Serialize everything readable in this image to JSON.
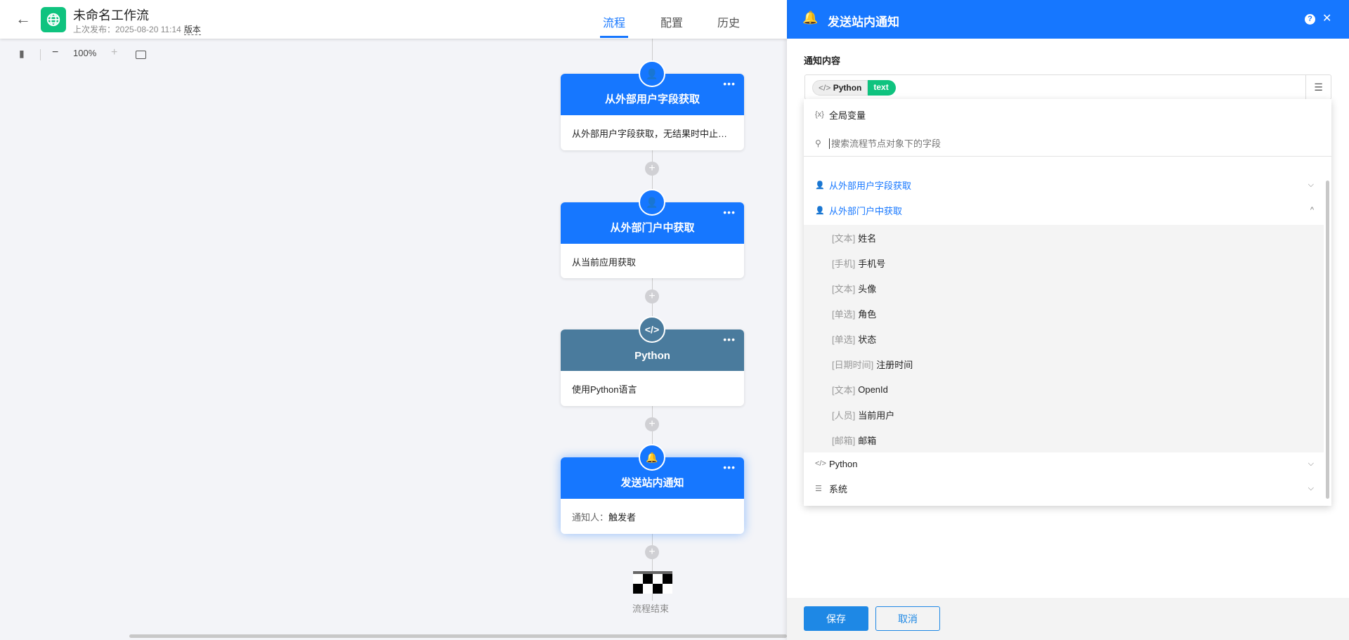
{
  "header": {
    "back_icon": "arrow-left-icon",
    "title": "未命名工作流",
    "published_label": "上次发布：2025-08-20 11:14",
    "version_link": "版本",
    "tabs": [
      {
        "label": "流程",
        "active": true
      },
      {
        "label": "配置"
      },
      {
        "label": "历史"
      }
    ]
  },
  "toolbar": {
    "zoom": "100%",
    "minus": "−",
    "plus": "+"
  },
  "nodes": [
    {
      "title": "从外部用户字段获取",
      "desc": "从外部用户字段获取，无结果时中止…",
      "color": "#1677ff"
    },
    {
      "title": "从外部门户中获取",
      "desc": "从当前应用获取",
      "color": "#1677ff"
    },
    {
      "title": "Python",
      "desc": "使用Python语言",
      "color": "#4a7b9d"
    },
    {
      "title": "发送站内通知",
      "desc_label": "通知人：",
      "desc_value": "触发者",
      "color": "#1677ff"
    }
  ],
  "more": "•••",
  "end_label": "流程结束",
  "panel": {
    "title": "发送站内通知",
    "help": "?",
    "close": "✕",
    "content_label": "通知内容",
    "tag_node": "Python",
    "tag_field": "text",
    "dropdown": {
      "global": "全局变量",
      "global_icon": "{x}",
      "search_placeholder": "搜索流程节点对象下的字段",
      "groups": [
        {
          "label": "从外部用户字段获取",
          "expanded": false
        },
        {
          "label": "从外部门户中获取",
          "expanded": true
        }
      ],
      "items": [
        {
          "type": "[文本]",
          "name": "姓名"
        },
        {
          "type": "[手机]",
          "name": "手机号"
        },
        {
          "type": "[文本]",
          "name": "头像"
        },
        {
          "type": "[单选]",
          "name": "角色"
        },
        {
          "type": "[单选]",
          "name": "状态"
        },
        {
          "type": "[日期时间]",
          "name": "注册时间"
        },
        {
          "type": "[文本]",
          "name": "OpenId"
        },
        {
          "type": "[人员]",
          "name": "当前用户"
        },
        {
          "type": "[邮箱]",
          "name": "邮箱"
        }
      ],
      "python": "Python",
      "system": "系统"
    },
    "save": "保存",
    "cancel": "取消"
  },
  "colors": {
    "primary": "#1677ff",
    "python": "#4a7b9d",
    "logo": "#0fc37f"
  }
}
